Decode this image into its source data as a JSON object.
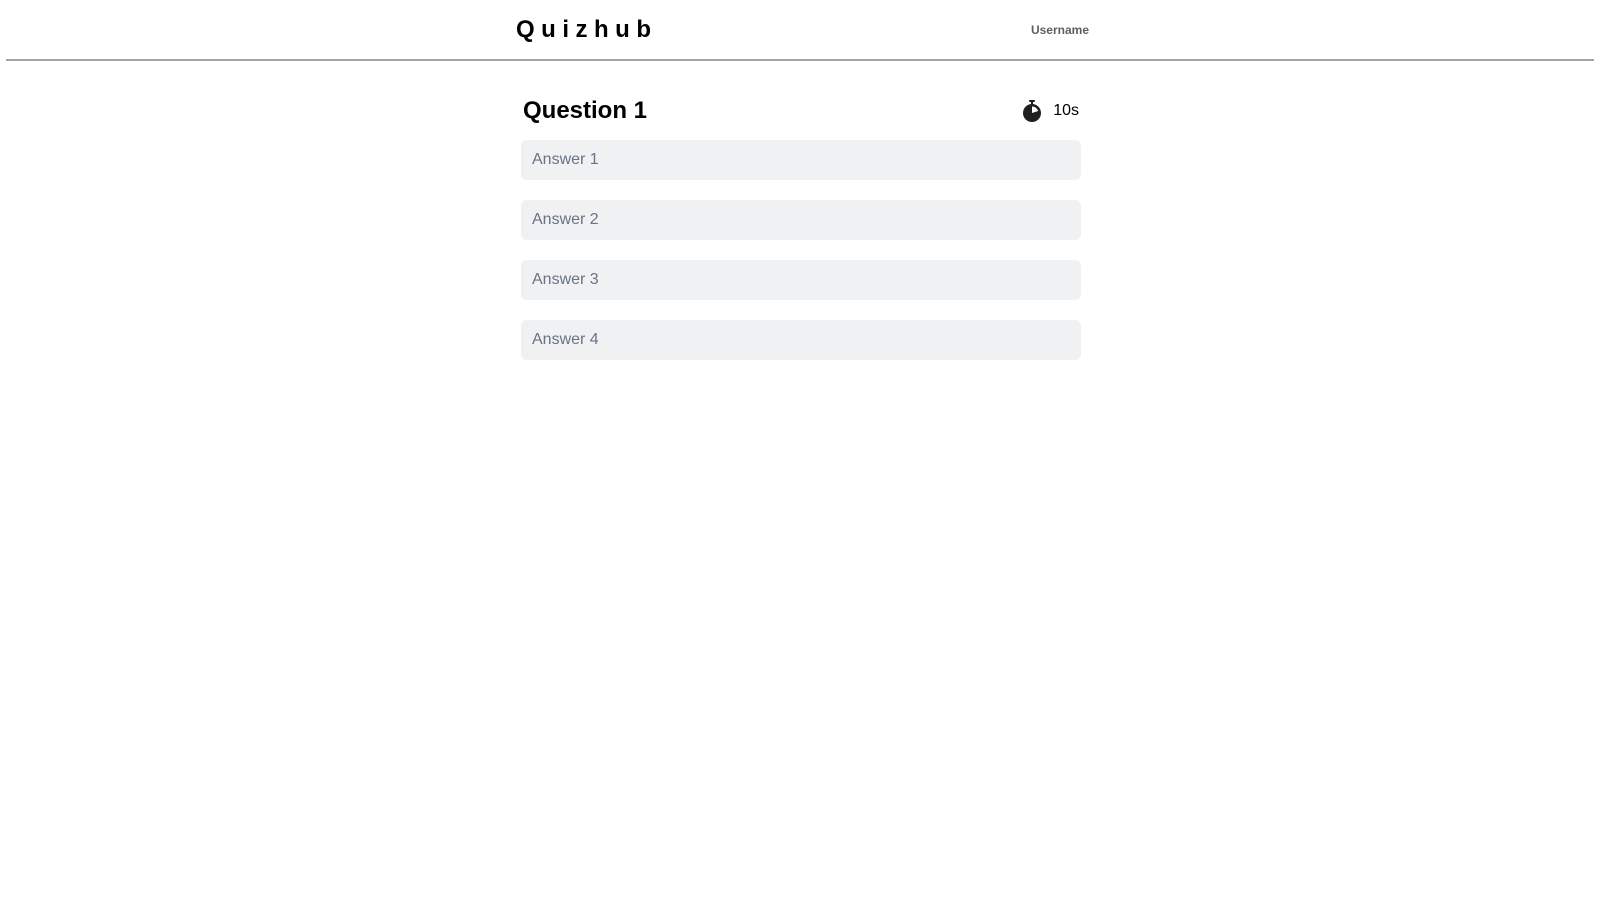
{
  "header": {
    "brand": "Quizhub",
    "username": "Username"
  },
  "question": {
    "title": "Question 1",
    "timer": {
      "icon": "stopwatch-icon",
      "text": "10s"
    },
    "answers": [
      {
        "label": "Answer 1"
      },
      {
        "label": "Answer 2"
      },
      {
        "label": "Answer 3"
      },
      {
        "label": "Answer 4"
      }
    ]
  },
  "colors": {
    "answer_bg": "#f0f1f3",
    "answer_text": "#687387",
    "divider": "#a3a3a3"
  }
}
